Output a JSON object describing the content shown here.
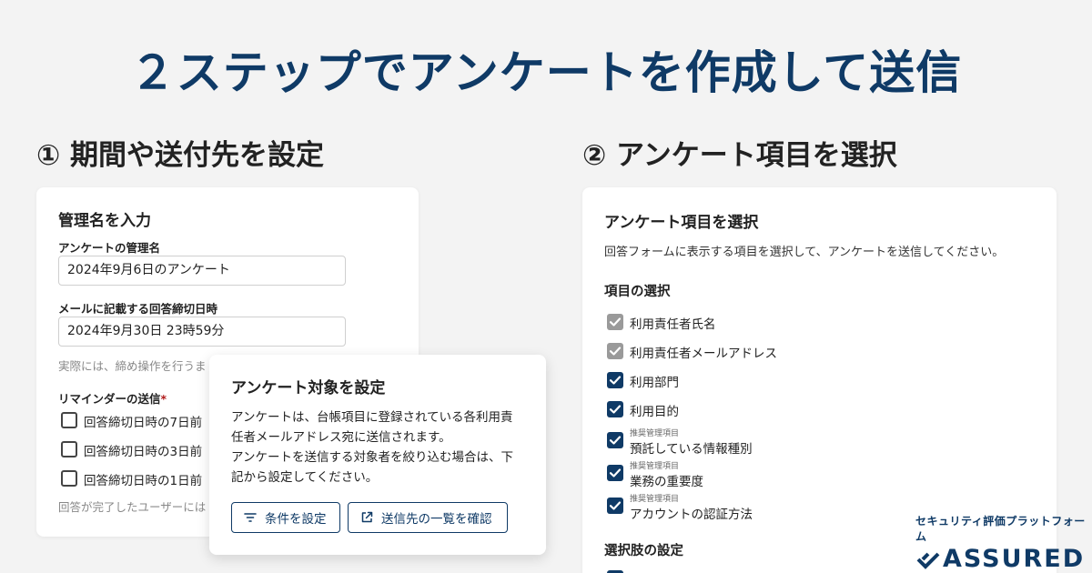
{
  "headline": "２ステップでアンケートを作成して送信",
  "step1_title": "① 期間や送付先を設定",
  "step2_title": "② アンケート項目を選択",
  "left_card": {
    "heading": "管理名を入力",
    "name_label": "アンケートの管理名",
    "name_value": "2024年9月6日のアンケート",
    "deadline_label": "メールに記載する回答締切日時",
    "deadline_value": "2024年9月30日 23時59分",
    "deadline_hint": "実際には、締め操作を行うま",
    "reminder_label": "リマインダーの送信",
    "required_mark": "*",
    "reminders": [
      {
        "label": "回答締切日時の7日前",
        "checked": false
      },
      {
        "label": "回答締切日時の3日前",
        "checked": false
      },
      {
        "label": "回答締切日時の1日前",
        "checked": false
      }
    ],
    "footer_hint": "回答が完了したユーザーには"
  },
  "popup": {
    "heading": "アンケート対象を設定",
    "line1": "アンケートは、台帳項目に登録されている各利用責",
    "line2": "任者メールアドレス宛に送信されます。",
    "line3": "アンケートを送信する対象者を絞り込む場合は、下",
    "line4": "記から設定してください。",
    "filter_button": "条件を設定",
    "list_button": "送信先の一覧を確認"
  },
  "right_card": {
    "heading": "アンケート項目を選択",
    "description": "回答フォームに表示する項目を選択して、アンケートを送信してください。",
    "items_heading": "項目の選択",
    "items": [
      {
        "label": "利用責任者氏名",
        "state": "disabled-checked",
        "tag": ""
      },
      {
        "label": "利用責任者メールアドレス",
        "state": "disabled-checked",
        "tag": ""
      },
      {
        "label": "利用部門",
        "state": "checked",
        "tag": ""
      },
      {
        "label": "利用目的",
        "state": "checked",
        "tag": ""
      },
      {
        "label": "預託している情報種別",
        "state": "checked",
        "tag": "推奨管理項目"
      },
      {
        "label": "業務の重要度",
        "state": "checked",
        "tag": "推奨管理項目"
      },
      {
        "label": "アカウントの認証方法",
        "state": "checked",
        "tag": "推奨管理項目"
      }
    ],
    "options_heading": "選択肢の設定"
  },
  "brand": {
    "tagline": "セキュリティ評価プラットフォーム",
    "name": "ASSURED"
  },
  "colors": {
    "navy": "#0f3a66",
    "background": "#f3f3f3",
    "disabled_check": "#9a9a9a",
    "required": "#b01a1a"
  }
}
